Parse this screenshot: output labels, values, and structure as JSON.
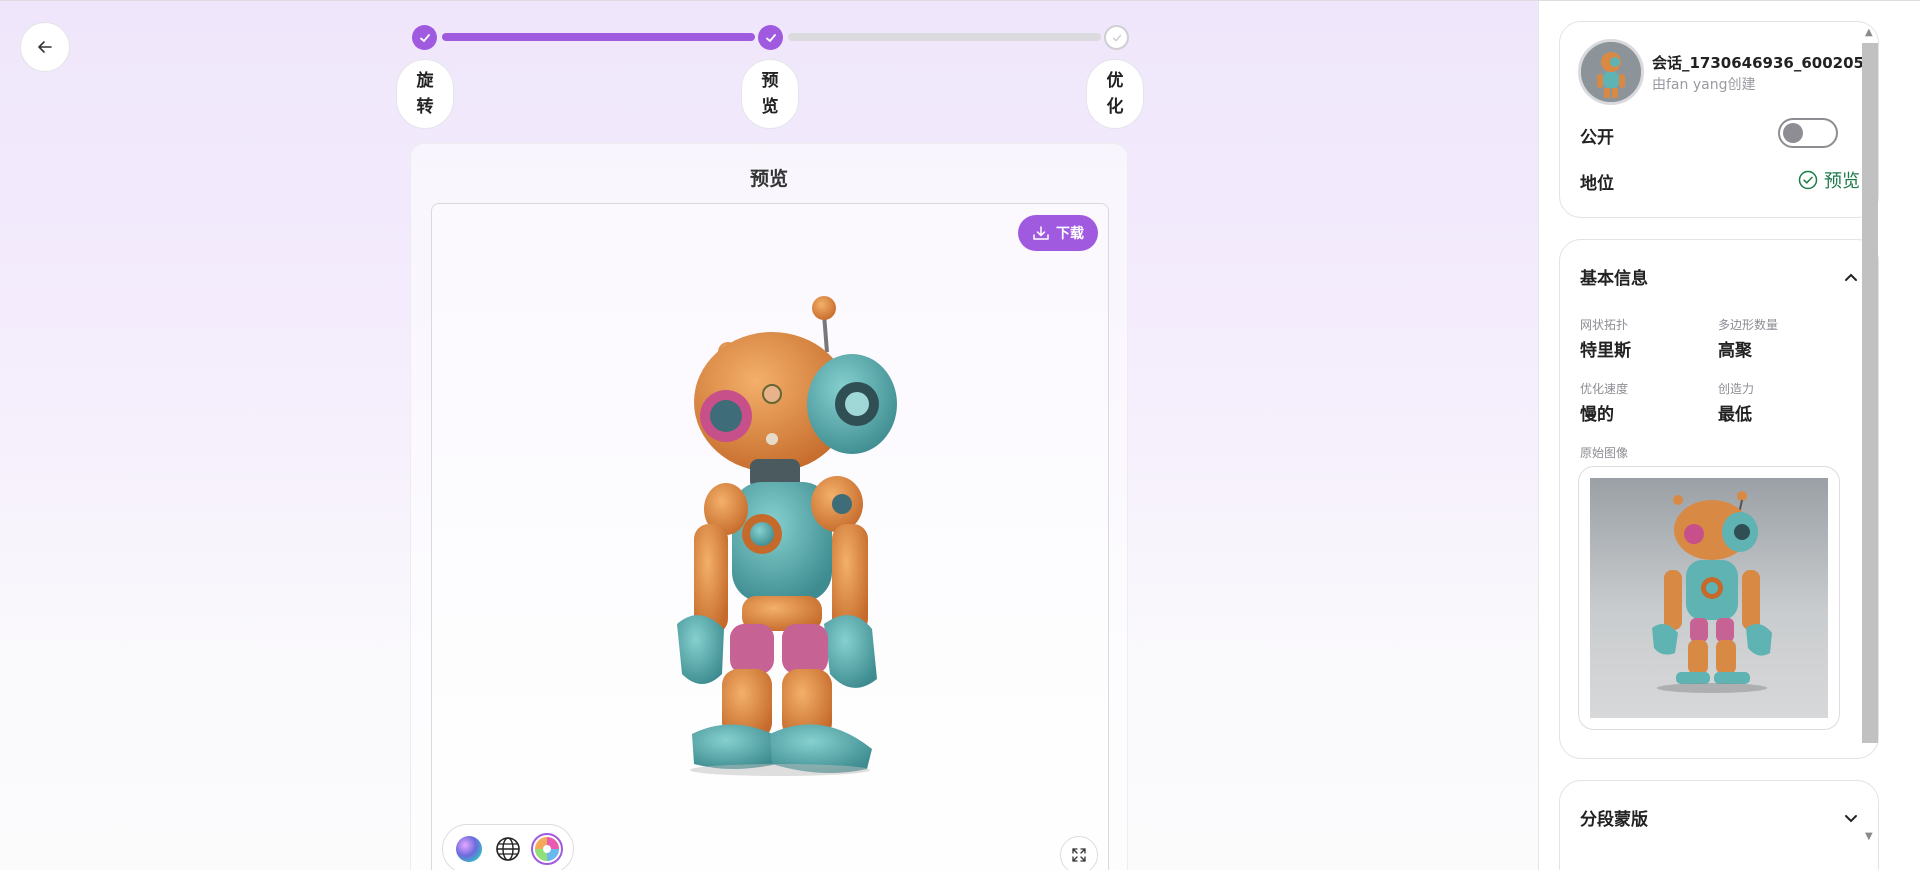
{
  "steps": [
    {
      "label": "旋转",
      "state": "done"
    },
    {
      "label": "预览",
      "state": "done"
    },
    {
      "label": "优化",
      "state": "todo"
    }
  ],
  "preview": {
    "title": "预览",
    "download_label": "下载"
  },
  "session": {
    "name": "会话_1730646936_600205",
    "creator": "由fan yang创建",
    "public_label": "公开",
    "public_on": false,
    "status_label": "地位",
    "status_value": "预览"
  },
  "basic_info": {
    "title": "基本信息",
    "fields": [
      {
        "key": "网状拓扑",
        "value": "特里斯"
      },
      {
        "key": "多边形数量",
        "value": "高聚"
      },
      {
        "key": "优化速度",
        "value": "慢的"
      },
      {
        "key": "创造力",
        "value": "最低"
      }
    ],
    "original_image_label": "原始图像"
  },
  "segment_mask": {
    "title": "分段蒙版"
  },
  "colors": {
    "accent": "#a05ae0",
    "status_green": "#1f7a4a"
  }
}
